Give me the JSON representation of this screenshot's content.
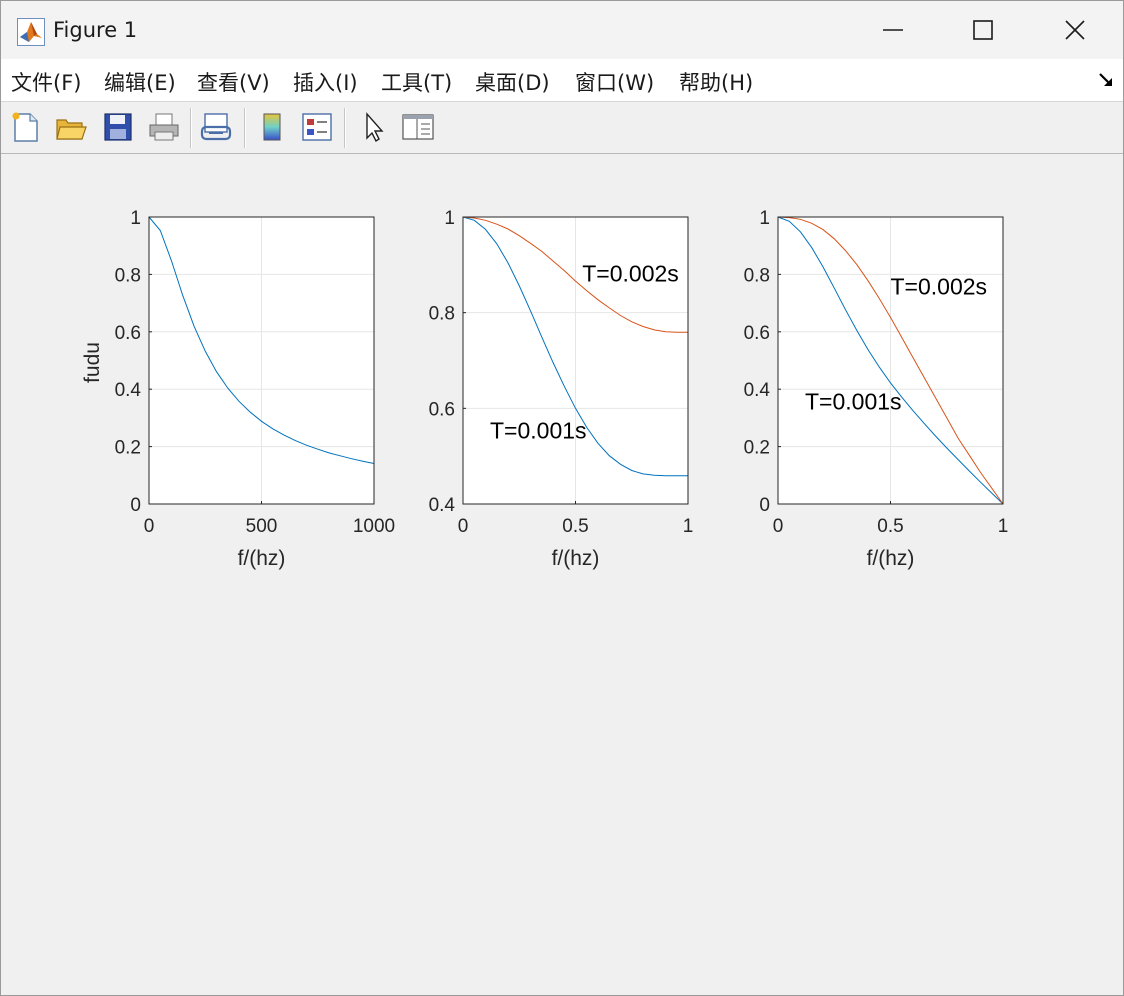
{
  "window": {
    "title": "Figure 1",
    "icon": "matlab-logo-icon",
    "controls": [
      "minimize-icon",
      "maximize-icon",
      "close-icon"
    ]
  },
  "menu": {
    "items": [
      "文件(F)",
      "编辑(E)",
      "查看(V)",
      "插入(I)",
      "工具(T)",
      "桌面(D)",
      "窗口(W)",
      "帮助(H)"
    ],
    "dock_icon": "dock-arrow-icon"
  },
  "toolbar": {
    "icons": [
      "new-figure-icon",
      "open-file-icon",
      "save-icon",
      "print-icon",
      "link-plot-icon",
      "colorbar-icon",
      "legend-icon",
      "pointer-icon",
      "property-editor-icon"
    ]
  },
  "colors": {
    "series1": "#0072BD",
    "series2": "#D95319",
    "grid": "#e6e6e6",
    "axes": "#262626"
  },
  "chart_data": [
    {
      "type": "line",
      "xlabel": "f/(hz)",
      "ylabel": "fudu",
      "xlim": [
        0,
        1000
      ],
      "ylim": [
        0,
        1
      ],
      "xticks": [
        "0",
        "500",
        "1000"
      ],
      "yticks": [
        "0",
        "0.2",
        "0.4",
        "0.6",
        "0.8",
        "1"
      ],
      "grid": true,
      "series": [
        {
          "color": "#0072BD",
          "x": [
            0,
            50,
            100,
            150,
            200,
            250,
            300,
            350,
            400,
            450,
            500,
            550,
            600,
            650,
            700,
            750,
            800,
            850,
            900,
            950,
            1000
          ],
          "y": [
            1.0,
            0.953,
            0.847,
            0.726,
            0.62,
            0.532,
            0.461,
            0.404,
            0.358,
            0.32,
            0.288,
            0.262,
            0.24,
            0.221,
            0.205,
            0.191,
            0.178,
            0.168,
            0.158,
            0.149,
            0.141
          ]
        }
      ],
      "annotations": []
    },
    {
      "type": "line",
      "xlabel": "f/(hz)",
      "ylabel": "",
      "xlim": [
        0,
        1
      ],
      "ylim": [
        0.4,
        1
      ],
      "xticks": [
        "0",
        "0.5",
        "1"
      ],
      "yticks": [
        "0.4",
        "0.6",
        "0.8",
        "1"
      ],
      "grid": true,
      "series": [
        {
          "color": "#0072BD",
          "x": [
            0,
            0.05,
            0.1,
            0.15,
            0.2,
            0.25,
            0.3,
            0.35,
            0.4,
            0.45,
            0.5,
            0.55,
            0.6,
            0.65,
            0.7,
            0.75,
            0.8,
            0.85,
            0.9,
            0.95,
            1.0
          ],
          "y": [
            1.0,
            0.993,
            0.974,
            0.944,
            0.904,
            0.856,
            0.804,
            0.749,
            0.696,
            0.646,
            0.6,
            0.56,
            0.527,
            0.501,
            0.483,
            0.47,
            0.463,
            0.46,
            0.459,
            0.459,
            0.459
          ]
        },
        {
          "color": "#D95319",
          "x": [
            0,
            0.05,
            0.1,
            0.15,
            0.2,
            0.25,
            0.3,
            0.35,
            0.4,
            0.45,
            0.5,
            0.55,
            0.6,
            0.65,
            0.7,
            0.75,
            0.8,
            0.85,
            0.9,
            0.95,
            1.0
          ],
          "y": [
            1.0,
            0.998,
            0.993,
            0.985,
            0.975,
            0.961,
            0.945,
            0.928,
            0.908,
            0.888,
            0.866,
            0.846,
            0.827,
            0.81,
            0.794,
            0.781,
            0.771,
            0.764,
            0.76,
            0.759,
            0.759
          ]
        }
      ],
      "annotations": [
        {
          "text": "T=0.002s",
          "x": 0.53,
          "y": 0.865
        },
        {
          "text": "T=0.001s",
          "x": 0.12,
          "y": 0.537
        }
      ]
    },
    {
      "type": "line",
      "xlabel": "f/(hz)",
      "ylabel": "",
      "xlim": [
        0,
        1
      ],
      "ylim": [
        0,
        1
      ],
      "xticks": [
        "0",
        "0.5",
        "1"
      ],
      "yticks": [
        "0",
        "0.2",
        "0.4",
        "0.6",
        "0.8",
        "1"
      ],
      "grid": true,
      "series": [
        {
          "color": "#0072BD",
          "x": [
            0,
            0.05,
            0.1,
            0.15,
            0.2,
            0.25,
            0.3,
            0.35,
            0.4,
            0.45,
            0.5,
            0.55,
            0.6,
            0.65,
            0.7,
            0.75,
            0.8,
            0.85,
            0.9,
            0.95,
            1.0
          ],
          "y": [
            1.0,
            0.985,
            0.948,
            0.893,
            0.826,
            0.752,
            0.677,
            0.605,
            0.538,
            0.477,
            0.422,
            0.372,
            0.325,
            0.28,
            0.237,
            0.195,
            0.155,
            0.115,
            0.076,
            0.038,
            0.0
          ]
        },
        {
          "color": "#D95319",
          "x": [
            0,
            0.05,
            0.1,
            0.15,
            0.2,
            0.25,
            0.3,
            0.35,
            0.4,
            0.45,
            0.5,
            0.55,
            0.6,
            0.65,
            0.7,
            0.75,
            0.8,
            0.85,
            0.9,
            0.95,
            1.0
          ],
          "y": [
            1.0,
            0.998,
            0.992,
            0.978,
            0.956,
            0.924,
            0.883,
            0.834,
            0.778,
            0.716,
            0.65,
            0.58,
            0.51,
            0.44,
            0.37,
            0.3,
            0.23,
            0.17,
            0.11,
            0.055,
            0.0
          ]
        }
      ],
      "annotations": [
        {
          "text": "T=0.002s",
          "x": 0.5,
          "y": 0.73
        },
        {
          "text": "T=0.001s",
          "x": 0.12,
          "y": 0.33
        }
      ]
    }
  ]
}
